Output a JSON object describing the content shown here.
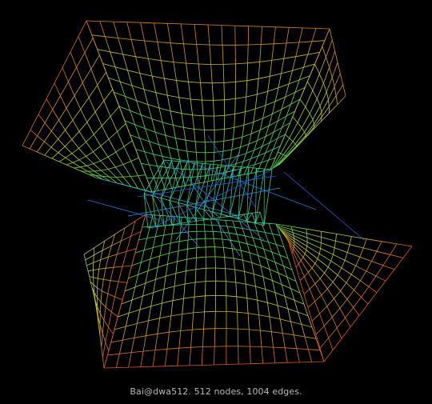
{
  "caption": "Bai@dwa512. 512 nodes, 1004 edges.",
  "graph": {
    "background": "#000000",
    "colors": {
      "outer": "#e03818",
      "mid_warm": "#c8c830",
      "mid": "#50d850",
      "inner": "#30c8c0",
      "core": "#2040e0"
    }
  }
}
